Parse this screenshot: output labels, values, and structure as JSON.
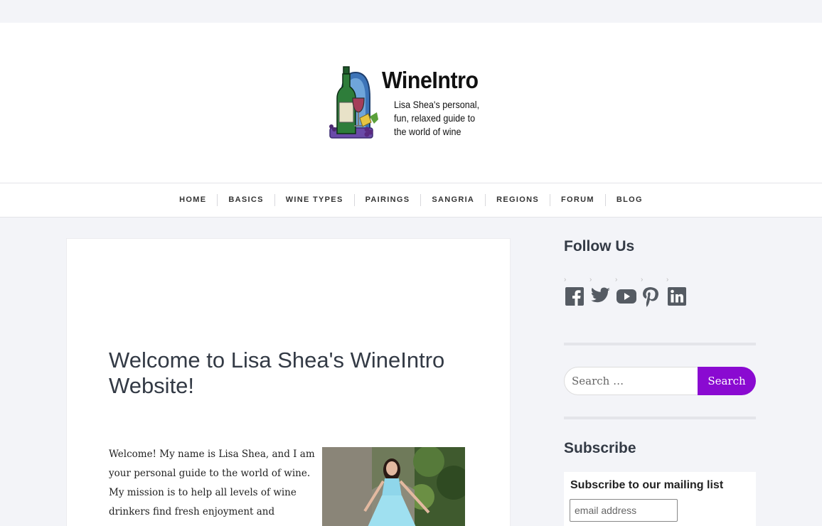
{
  "site": {
    "logo_title": "WineIntro",
    "logo_tagline": "Lisa Shea's personal, fun, relaxed guide to the world of wine"
  },
  "nav": {
    "items": [
      {
        "label": "HOME"
      },
      {
        "label": "BASICS"
      },
      {
        "label": "WINE TYPES"
      },
      {
        "label": "PAIRINGS"
      },
      {
        "label": "SANGRIA"
      },
      {
        "label": "REGIONS"
      },
      {
        "label": "FORUM"
      },
      {
        "label": "BLOG"
      }
    ]
  },
  "main": {
    "title": "Welcome to Lisa Shea's WineIntro Website!",
    "intro": "Welcome! My name is Lisa Shea, and I am your personal guide to the world of wine. My mission is to help all levels of wine drinkers find fresh enjoyment and interest"
  },
  "sidebar": {
    "follow_heading": "Follow Us",
    "social_icons": [
      "facebook-icon",
      "twitter-icon",
      "youtube-icon",
      "pinterest-icon",
      "linkedin-icon"
    ],
    "search_placeholder": "Search …",
    "search_button": "Search",
    "subscribe_heading": "Subscribe",
    "subscribe_label": "Subscribe to our mailing list",
    "email_placeholder": "email address"
  },
  "colors": {
    "accent": "#8a0ad1",
    "page_bg": "#f3f4f8",
    "icon": "#555b63"
  }
}
